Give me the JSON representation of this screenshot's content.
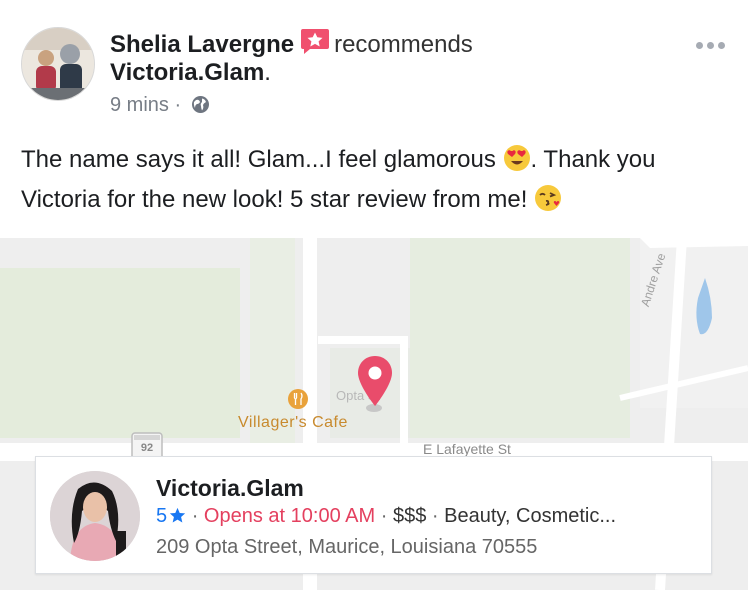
{
  "post": {
    "author": "Shelia Lavergne",
    "recommend_text": "recommends",
    "page_name": "Victoria.Glam",
    "page_dot": ".",
    "time": "9 mins",
    "time_sep": "·",
    "body_part1": "The name says it all! Glam...I feel glamorous",
    "body_part2": ".  Thank you Victoria for the new look! 5 star review from me!",
    "icons": {
      "recommend": "recommendation-star-icon",
      "audience": "globe-icon",
      "more": "more-options-icon",
      "emoji1": "heart-eyes-emoji",
      "emoji2": "kissing-face-emoji"
    }
  },
  "map": {
    "cafe_label": "Villager's Cafe",
    "street_label": "E Lafayette St",
    "road_label": "Andre Ave",
    "place_label": "Opta St",
    "route_number": "92",
    "colors": {
      "pin": "#e94c6b",
      "park": "#dfe9d6",
      "road": "#ffffff",
      "water": "#9fc6ea"
    }
  },
  "business": {
    "name": "Victoria.Glam",
    "rating": "5",
    "status": "Opens at 10:00 AM",
    "price": "$$$",
    "category": "Beauty, Cosmetic...",
    "address": "209 Opta Street, Maurice, Louisiana 70555",
    "sep": "·",
    "colors": {
      "rating": "#1877f2",
      "status": "#e4405f"
    }
  }
}
